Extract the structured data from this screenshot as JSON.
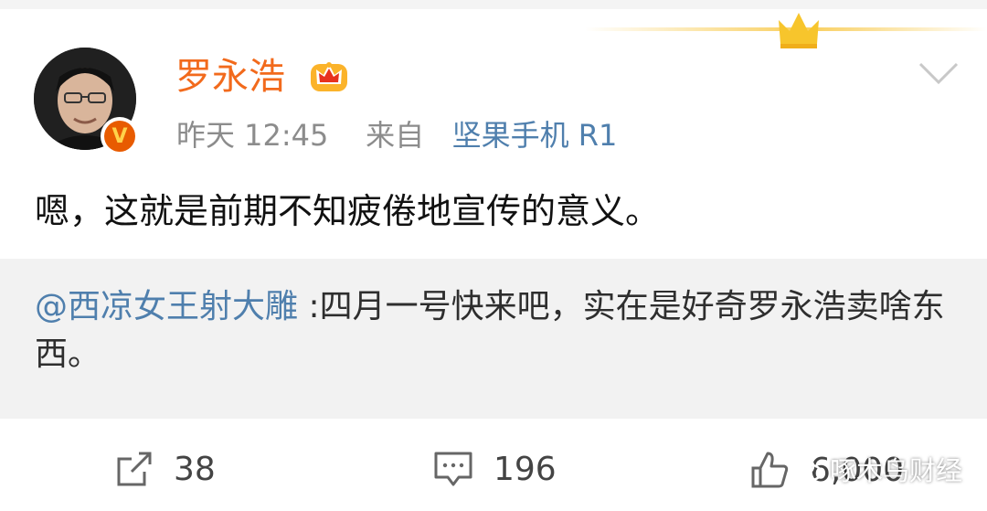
{
  "post": {
    "author": "罗永浩",
    "time": "昨天 12:45",
    "source_prefix": "来自",
    "device": "坚果手机 R1",
    "content": "嗯，这就是前期不知疲倦地宣传的意义。"
  },
  "quote": {
    "mention": "@西凉女王射大雕",
    "text": " :四月一号快来吧，实在是好奇罗永浩卖啥东西。"
  },
  "actions": {
    "repost_count": "38",
    "comment_count": "196",
    "like_count": "6,000"
  },
  "watermark": "啄木鸟财经",
  "colors": {
    "username": "#f26a1c",
    "link": "#4f7fad",
    "quote_bg": "#f2f2f2",
    "meta": "#8c8c8c"
  },
  "icons": [
    "crown-icon",
    "verified-badge-icon",
    "chevron-down-icon",
    "repost-icon",
    "comment-icon",
    "like-icon",
    "wechat-icon"
  ]
}
